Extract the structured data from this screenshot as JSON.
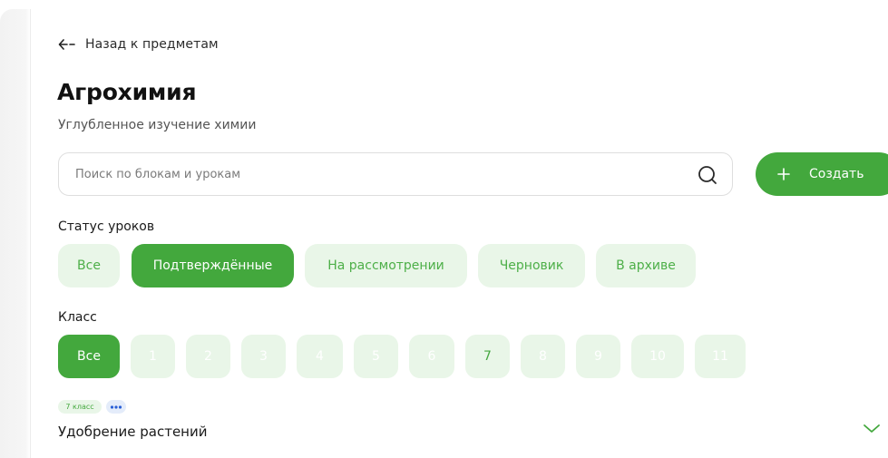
{
  "back": {
    "label": "Назад к предметам"
  },
  "subject": {
    "title": "Агрохимия",
    "subtitle": "Углубленное изучение химии"
  },
  "search": {
    "placeholder": "Поиск по блокам и урокам",
    "value": ""
  },
  "create_button": {
    "label": "Создать"
  },
  "status_filter": {
    "label": "Статус уроков",
    "options": [
      {
        "label": "Все",
        "selected": false
      },
      {
        "label": "Подтверждённые",
        "selected": true
      },
      {
        "label": "На рассмотрении",
        "selected": false
      },
      {
        "label": "Черновик",
        "selected": false
      },
      {
        "label": "В архиве",
        "selected": false
      }
    ]
  },
  "class_filter": {
    "label": "Класс",
    "options": [
      {
        "label": "Все",
        "selected": true
      },
      {
        "label": "1",
        "available": false
      },
      {
        "label": "2",
        "available": false
      },
      {
        "label": "3",
        "available": false
      },
      {
        "label": "4",
        "available": false
      },
      {
        "label": "5",
        "available": false
      },
      {
        "label": "6",
        "available": false
      },
      {
        "label": "7",
        "available": true
      },
      {
        "label": "8",
        "available": false
      },
      {
        "label": "9",
        "available": false
      },
      {
        "label": "10",
        "available": false
      },
      {
        "label": "11",
        "available": false
      }
    ]
  },
  "block": {
    "grade_tag": "7 класс",
    "more_icon": "ellipsis-icon",
    "title": "Удобрение растений",
    "toggle_icon": "chevron-down-icon"
  },
  "colors": {
    "accent": "#43a83d",
    "accent_light": "#e9f6e8",
    "border": "#dedede"
  }
}
